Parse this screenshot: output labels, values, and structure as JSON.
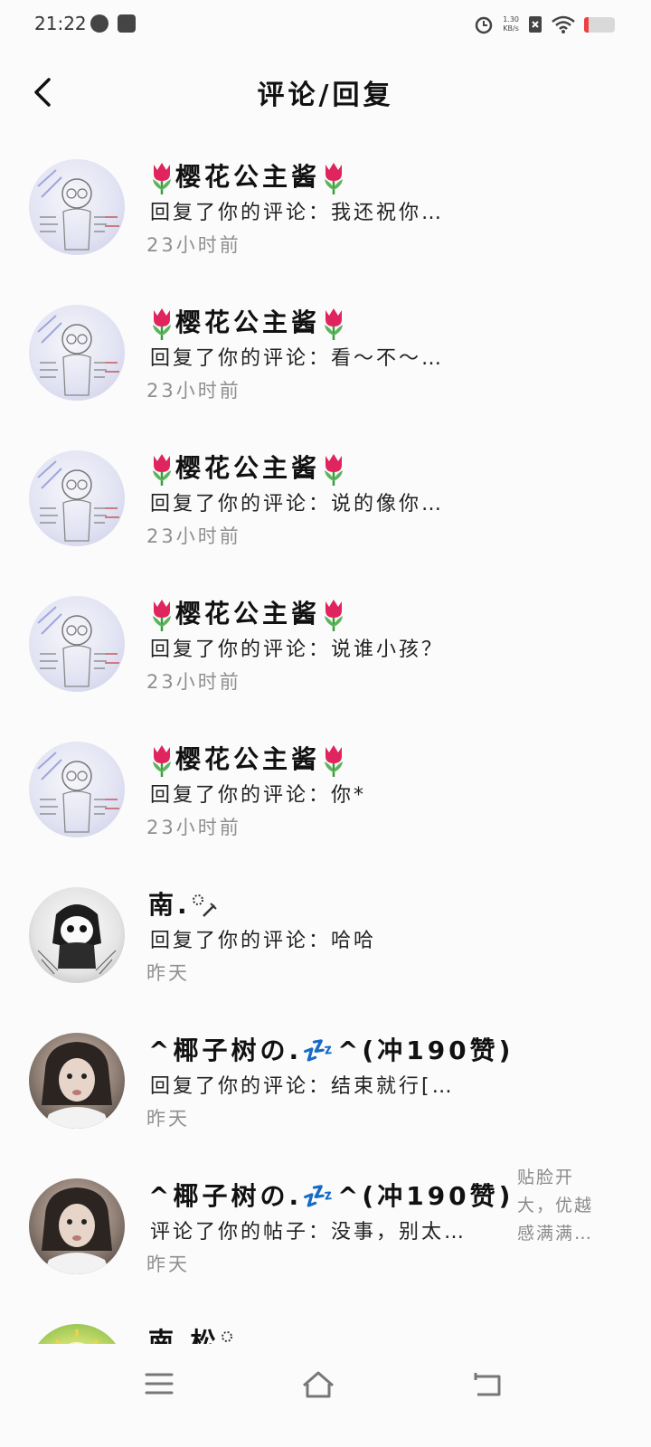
{
  "status_bar": {
    "time": "21:22",
    "net_speed": "1.30",
    "net_unit": "KB/s"
  },
  "header": {
    "title": "评论/回复"
  },
  "items": [
    {
      "name": "樱花公主酱",
      "line": "回复了你的评论：我还祝你…",
      "time": "23小时前",
      "avatar": "sketch-avatar"
    },
    {
      "name": "樱花公主酱",
      "line": "回复了你的评论：看～不～…",
      "time": "23小时前",
      "avatar": "sketch-avatar"
    },
    {
      "name": "樱花公主酱",
      "line": "回复了你的评论：说的像你…",
      "time": "23小时前",
      "avatar": "sketch-avatar"
    },
    {
      "name": "樱花公主酱",
      "line": "回复了你的评论：说谁小孩？",
      "time": "23小时前",
      "avatar": "sketch-avatar"
    },
    {
      "name": "樱花公主酱",
      "line": "回复了你的评论：你*",
      "time": "23小时前",
      "avatar": "sketch-avatar"
    },
    {
      "name": "南.",
      "line": "回复了你的评论：哈哈",
      "time": "昨天",
      "avatar": "manga-avatar"
    },
    {
      "name": "^椰子树の.💤^(冲190赞)",
      "line": "回复了你的评论：结束就行[…",
      "time": "昨天",
      "avatar": "photo-avatar"
    },
    {
      "name": "^椰子树の.💤^(冲190赞)",
      "line": "评论了你的帖子：没事，别太…",
      "time": "昨天",
      "avatar": "photo-avatar",
      "post_preview": "贴脸开大，优越感满满…"
    },
    {
      "name": "南.松",
      "avatar": "sun-avatar"
    }
  ],
  "colors": {
    "background": "#fbfbfc",
    "timestamp": "#8f8f8f",
    "battery_low": "#ef3f3f"
  }
}
